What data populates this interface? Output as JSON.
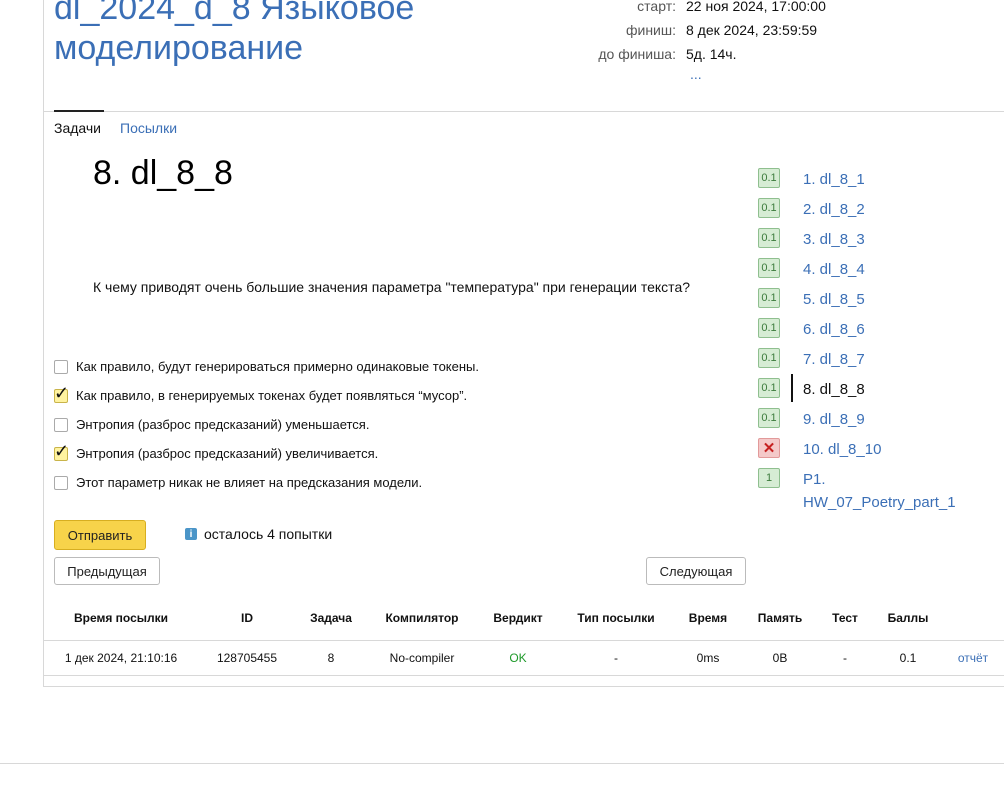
{
  "contest": {
    "title_partial": "dl_2024_d_8 Языковое",
    "title_line2": "моделирование",
    "meta": [
      {
        "label": "старт:",
        "value": "22 ноя 2024, 17:00:00"
      },
      {
        "label": "финиш:",
        "value": "8 дек 2024, 23:59:59"
      },
      {
        "label": "до финиша:",
        "value": "5д. 14ч."
      }
    ],
    "more": "..."
  },
  "tabs": [
    {
      "label": "Задачи",
      "active": true
    },
    {
      "label": "Посылки",
      "active": false
    }
  ],
  "problem": {
    "title": "8. dl_8_8",
    "question": "К чему приводят очень большие значения параметра \"температура\" при генерации текста?",
    "options": [
      {
        "label": "Как правило, будут генерироваться примерно одинаковые токены.",
        "checked": false
      },
      {
        "label": "Как правило, в генерируемых токенах будет появляться “мусор”.",
        "checked": true
      },
      {
        "label": "Энтропия (разброс предсказаний) уменьшается.",
        "checked": false
      },
      {
        "label": "Энтропия (разброс предсказаний) увеличивается.",
        "checked": true
      },
      {
        "label": "Этот параметр никак не влияет на предсказания модели.",
        "checked": false
      }
    ],
    "submit_label": "Отправить",
    "attempts_icon": "i",
    "attempts_text": "осталось 4 попытки",
    "prev_label": "Предыдущая",
    "next_label": "Следующая"
  },
  "problem_list": [
    {
      "badge": "0.1",
      "label": "1. dl_8_1",
      "status": "ok"
    },
    {
      "badge": "0.1",
      "label": "2. dl_8_2",
      "status": "ok"
    },
    {
      "badge": "0.1",
      "label": "3. dl_8_3",
      "status": "ok"
    },
    {
      "badge": "0.1",
      "label": "4. dl_8_4",
      "status": "ok"
    },
    {
      "badge": "0.1",
      "label": "5. dl_8_5",
      "status": "ok"
    },
    {
      "badge": "0.1",
      "label": "6. dl_8_6",
      "status": "ok"
    },
    {
      "badge": "0.1",
      "label": "7. dl_8_7",
      "status": "ok"
    },
    {
      "badge": "0.1",
      "label": "8. dl_8_8",
      "status": "current"
    },
    {
      "badge": "0.1",
      "label": "9. dl_8_9",
      "status": "ok"
    },
    {
      "badge": "✕",
      "label": "10. dl_8_10",
      "status": "fail"
    },
    {
      "badge": "1",
      "label": "P1. HW_07_Poetry_part_1",
      "status": "ok"
    }
  ],
  "submissions": {
    "headers": [
      "Время посылки",
      "ID",
      "Задача",
      "Компилятор",
      "Вердикт",
      "Тип посылки",
      "Время",
      "Память",
      "Тест",
      "Баллы"
    ],
    "rows": [
      {
        "time": "1 дек 2024, 21:10:16",
        "id": "128705455",
        "task": "8",
        "compiler": "No-compiler",
        "verdict": "OK",
        "type": "-",
        "exec_time": "0ms",
        "memory": "0B",
        "test": "-",
        "score": "0.1",
        "report": "отчёт"
      }
    ]
  },
  "colors": {
    "link": "#3b6fb6",
    "ok": "#1f9a2b",
    "submit": "#f7d34a",
    "badge_ok": "#d6ecd4",
    "badge_fail": "#f4c9c9"
  }
}
